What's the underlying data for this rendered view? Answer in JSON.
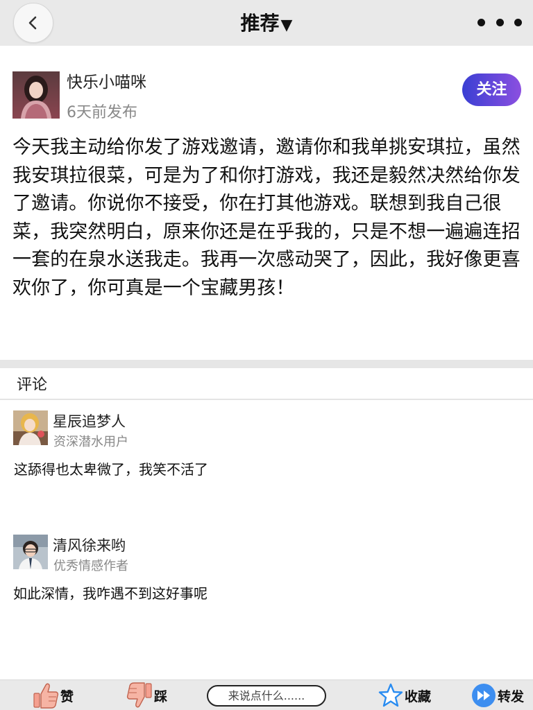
{
  "header": {
    "title": "推荐",
    "title_arrow": "▼"
  },
  "post": {
    "author": "快乐小喵咪",
    "time": "6天前发布",
    "follow_label": "关注",
    "content": "今天我主动给你发了游戏邀请，邀请你和我单挑安琪拉，虽然我安琪拉很菜，可是为了和你打游戏，我还是毅然决然给你发了邀请。你说你不接受，你在打其他游戏。联想到我自己很菜，我突然明白，原来你还是在乎我的，只是不想一遍遍连招一套的在泉水送我走。我再一次感动哭了，因此，我好像更喜欢你了，你可真是一个宝藏男孩！"
  },
  "comments": {
    "title": "评论",
    "items": [
      {
        "name": "星辰追梦人",
        "tag": "资深潜水用户",
        "text": "这舔得也太卑微了，我笑不活了"
      },
      {
        "name": "清风徐来哟",
        "tag": "优秀情感作者",
        "text": "如此深情，我咋遇不到这好事呢"
      }
    ]
  },
  "bottom_bar": {
    "like_label": "赞",
    "dislike_label": "踩",
    "input_placeholder": "来说点什么......",
    "favorite_label": "收藏",
    "share_label": "转发"
  },
  "colors": {
    "follow_gradient_start": "#3a3fd3",
    "follow_gradient_end": "#8b4fe0",
    "like_icon": "#f4a090",
    "favorite_icon": "#2a8cf0",
    "share_icon": "#3d8ef0"
  },
  "icons": {
    "back": "chevron-left-icon",
    "more": "more-dots-icon",
    "like": "thumbs-up-icon",
    "dislike": "thumbs-down-icon",
    "favorite": "star-icon",
    "share": "forward-icon"
  }
}
